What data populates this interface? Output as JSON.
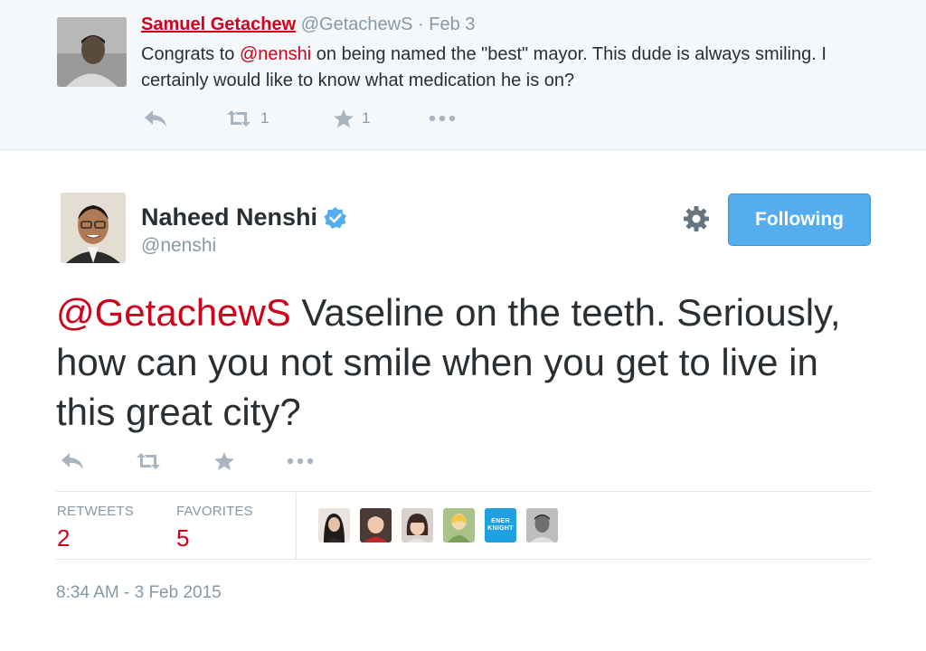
{
  "reply": {
    "name": "Samuel Getachew",
    "handle": "@GetachewS",
    "separator": "·",
    "date": "Feb 3",
    "text_before": "Congrats to ",
    "mention": "@nenshi",
    "text_after": " on being named the \"best\" mayor. This dude is always smiling. I certainly would like to know what medication he is on?",
    "retweets": "1",
    "favorites": "1"
  },
  "tweet": {
    "name": "Naheed Nenshi",
    "handle": "@nenshi",
    "follow_label": "Following",
    "mention": "@GetachewS",
    "text": " Vaseline on the teeth. Seriously, how can you not smile when you get to live in this great city?",
    "stats": {
      "retweets_label": "RETWEETS",
      "retweets_value": "2",
      "favorites_label": "FAVORITES",
      "favorites_value": "5"
    },
    "favoriter_avatars": [
      {
        "name": "avatar-woman-dark-hair"
      },
      {
        "name": "avatar-woman-red-top"
      },
      {
        "name": "avatar-woman-bangs"
      },
      {
        "name": "avatar-cartoon"
      },
      {
        "name": "avatar-brand-logo",
        "text": "ENER KNIGHT"
      },
      {
        "name": "avatar-man-gray"
      }
    ],
    "timestamp": "8:34 AM - 3 Feb 2015"
  },
  "icons": [
    "reply-icon",
    "retweet-icon",
    "favorite-icon",
    "more-icon",
    "gear-icon",
    "verified-icon"
  ],
  "colors": {
    "accent_red": "#d0021b",
    "button_blue": "#55acee",
    "muted_gray": "#8899a6",
    "icon_gray": "#a8b5c0",
    "verified_blue": "#55acee"
  }
}
